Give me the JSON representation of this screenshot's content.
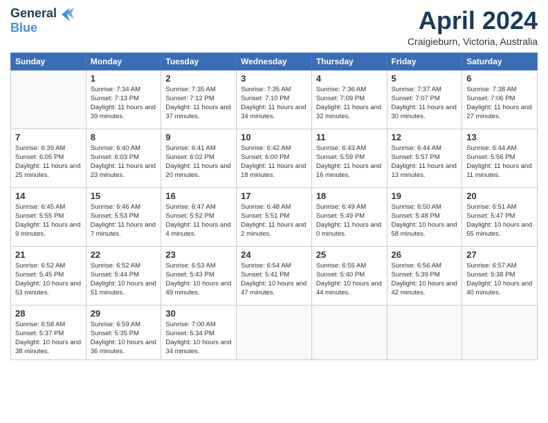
{
  "header": {
    "logo_line1": "General",
    "logo_line2": "Blue",
    "month_title": "April 2024",
    "location": "Craigieburn, Victoria, Australia"
  },
  "days_of_week": [
    "Sunday",
    "Monday",
    "Tuesday",
    "Wednesday",
    "Thursday",
    "Friday",
    "Saturday"
  ],
  "weeks": [
    [
      {
        "day": "",
        "sunrise": "",
        "sunset": "",
        "daylight": ""
      },
      {
        "day": "1",
        "sunrise": "Sunrise: 7:34 AM",
        "sunset": "Sunset: 7:13 PM",
        "daylight": "Daylight: 11 hours and 39 minutes."
      },
      {
        "day": "2",
        "sunrise": "Sunrise: 7:35 AM",
        "sunset": "Sunset: 7:12 PM",
        "daylight": "Daylight: 11 hours and 37 minutes."
      },
      {
        "day": "3",
        "sunrise": "Sunrise: 7:35 AM",
        "sunset": "Sunset: 7:10 PM",
        "daylight": "Daylight: 11 hours and 34 minutes."
      },
      {
        "day": "4",
        "sunrise": "Sunrise: 7:36 AM",
        "sunset": "Sunset: 7:09 PM",
        "daylight": "Daylight: 11 hours and 32 minutes."
      },
      {
        "day": "5",
        "sunrise": "Sunrise: 7:37 AM",
        "sunset": "Sunset: 7:07 PM",
        "daylight": "Daylight: 11 hours and 30 minutes."
      },
      {
        "day": "6",
        "sunrise": "Sunrise: 7:38 AM",
        "sunset": "Sunset: 7:06 PM",
        "daylight": "Daylight: 11 hours and 27 minutes."
      }
    ],
    [
      {
        "day": "7",
        "sunrise": "Sunrise: 6:39 AM",
        "sunset": "Sunset: 6:05 PM",
        "daylight": "Daylight: 11 hours and 25 minutes."
      },
      {
        "day": "8",
        "sunrise": "Sunrise: 6:40 AM",
        "sunset": "Sunset: 6:03 PM",
        "daylight": "Daylight: 11 hours and 23 minutes."
      },
      {
        "day": "9",
        "sunrise": "Sunrise: 6:41 AM",
        "sunset": "Sunset: 6:02 PM",
        "daylight": "Daylight: 11 hours and 20 minutes."
      },
      {
        "day": "10",
        "sunrise": "Sunrise: 6:42 AM",
        "sunset": "Sunset: 6:00 PM",
        "daylight": "Daylight: 11 hours and 18 minutes."
      },
      {
        "day": "11",
        "sunrise": "Sunrise: 6:43 AM",
        "sunset": "Sunset: 5:59 PM",
        "daylight": "Daylight: 11 hours and 16 minutes."
      },
      {
        "day": "12",
        "sunrise": "Sunrise: 6:44 AM",
        "sunset": "Sunset: 5:57 PM",
        "daylight": "Daylight: 11 hours and 13 minutes."
      },
      {
        "day": "13",
        "sunrise": "Sunrise: 6:44 AM",
        "sunset": "Sunset: 5:56 PM",
        "daylight": "Daylight: 11 hours and 11 minutes."
      }
    ],
    [
      {
        "day": "14",
        "sunrise": "Sunrise: 6:45 AM",
        "sunset": "Sunset: 5:55 PM",
        "daylight": "Daylight: 11 hours and 9 minutes."
      },
      {
        "day": "15",
        "sunrise": "Sunrise: 6:46 AM",
        "sunset": "Sunset: 5:53 PM",
        "daylight": "Daylight: 11 hours and 7 minutes."
      },
      {
        "day": "16",
        "sunrise": "Sunrise: 6:47 AM",
        "sunset": "Sunset: 5:52 PM",
        "daylight": "Daylight: 11 hours and 4 minutes."
      },
      {
        "day": "17",
        "sunrise": "Sunrise: 6:48 AM",
        "sunset": "Sunset: 5:51 PM",
        "daylight": "Daylight: 11 hours and 2 minutes."
      },
      {
        "day": "18",
        "sunrise": "Sunrise: 6:49 AM",
        "sunset": "Sunset: 5:49 PM",
        "daylight": "Daylight: 11 hours and 0 minutes."
      },
      {
        "day": "19",
        "sunrise": "Sunrise: 6:50 AM",
        "sunset": "Sunset: 5:48 PM",
        "daylight": "Daylight: 10 hours and 58 minutes."
      },
      {
        "day": "20",
        "sunrise": "Sunrise: 6:51 AM",
        "sunset": "Sunset: 5:47 PM",
        "daylight": "Daylight: 10 hours and 55 minutes."
      }
    ],
    [
      {
        "day": "21",
        "sunrise": "Sunrise: 6:52 AM",
        "sunset": "Sunset: 5:45 PM",
        "daylight": "Daylight: 10 hours and 53 minutes."
      },
      {
        "day": "22",
        "sunrise": "Sunrise: 6:52 AM",
        "sunset": "Sunset: 5:44 PM",
        "daylight": "Daylight: 10 hours and 51 minutes."
      },
      {
        "day": "23",
        "sunrise": "Sunrise: 6:53 AM",
        "sunset": "Sunset: 5:43 PM",
        "daylight": "Daylight: 10 hours and 49 minutes."
      },
      {
        "day": "24",
        "sunrise": "Sunrise: 6:54 AM",
        "sunset": "Sunset: 5:41 PM",
        "daylight": "Daylight: 10 hours and 47 minutes."
      },
      {
        "day": "25",
        "sunrise": "Sunrise: 6:55 AM",
        "sunset": "Sunset: 5:40 PM",
        "daylight": "Daylight: 10 hours and 44 minutes."
      },
      {
        "day": "26",
        "sunrise": "Sunrise: 6:56 AM",
        "sunset": "Sunset: 5:39 PM",
        "daylight": "Daylight: 10 hours and 42 minutes."
      },
      {
        "day": "27",
        "sunrise": "Sunrise: 6:57 AM",
        "sunset": "Sunset: 5:38 PM",
        "daylight": "Daylight: 10 hours and 40 minutes."
      }
    ],
    [
      {
        "day": "28",
        "sunrise": "Sunrise: 6:58 AM",
        "sunset": "Sunset: 5:37 PM",
        "daylight": "Daylight: 10 hours and 38 minutes."
      },
      {
        "day": "29",
        "sunrise": "Sunrise: 6:59 AM",
        "sunset": "Sunset: 5:35 PM",
        "daylight": "Daylight: 10 hours and 36 minutes."
      },
      {
        "day": "30",
        "sunrise": "Sunrise: 7:00 AM",
        "sunset": "Sunset: 5:34 PM",
        "daylight": "Daylight: 10 hours and 34 minutes."
      },
      {
        "day": "",
        "sunrise": "",
        "sunset": "",
        "daylight": ""
      },
      {
        "day": "",
        "sunrise": "",
        "sunset": "",
        "daylight": ""
      },
      {
        "day": "",
        "sunrise": "",
        "sunset": "",
        "daylight": ""
      },
      {
        "day": "",
        "sunrise": "",
        "sunset": "",
        "daylight": ""
      }
    ]
  ]
}
